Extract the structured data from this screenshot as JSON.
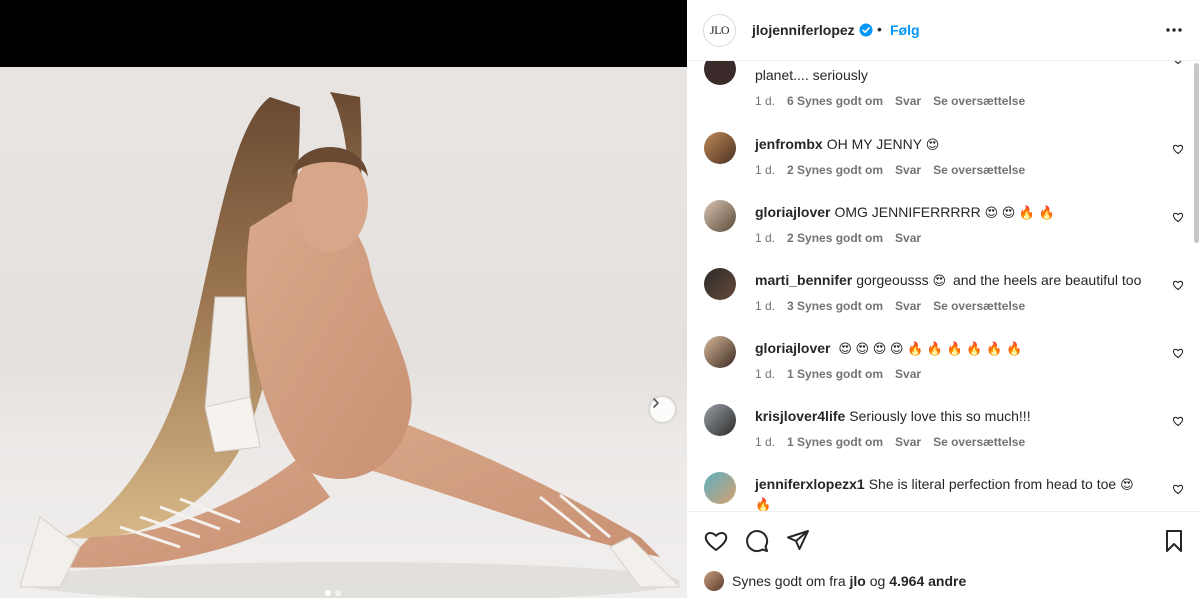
{
  "post": {
    "username": "jlojenniferlopez",
    "logo_text": "JLO",
    "separator": "•",
    "follow_label": "Følg"
  },
  "icons": {
    "verified": "verified-badge-icon",
    "more": "more-options-icon",
    "next": "chevron-right-icon",
    "heart": "heart-icon",
    "comment": "comment-icon",
    "share": "share-icon",
    "save": "bookmark-icon"
  },
  "colors": {
    "accent": "#0095f6",
    "text": "#262626",
    "muted": "#737373"
  },
  "comments": [
    {
      "user": "",
      "text": "planet.... seriously",
      "time": "1 d.",
      "likes": "6 Synes godt om",
      "reply": "Svar",
      "translate": "Se oversættelse"
    },
    {
      "user": "jenfrombx",
      "text": "OH MY JENNY",
      "emoji": "😍",
      "time": "1 d.",
      "likes": "2 Synes godt om",
      "reply": "Svar",
      "translate": "Se oversættelse"
    },
    {
      "user": "gloriajlover",
      "text": "OMG JENNIFERRRRR",
      "emoji": "😍 😍 🔥 🔥",
      "time": "1 d.",
      "likes": "2 Synes godt om",
      "reply": "Svar"
    },
    {
      "user": "marti_bennifer",
      "text": "gorgeousss",
      "emoji": "😍",
      "text2": "and the heels are beautiful too",
      "time": "1 d.",
      "likes": "3 Synes godt om",
      "reply": "Svar",
      "translate": "Se oversættelse"
    },
    {
      "user": "gloriajlover",
      "text": "",
      "emoji": "😍 😍 😍 😍 🔥 🔥 🔥 🔥 🔥 🔥",
      "time": "1 d.",
      "likes": "1 Synes godt om",
      "reply": "Svar"
    },
    {
      "user": "krisjlover4life",
      "text": "Seriously love this so much!!!",
      "time": "1 d.",
      "likes": "1 Synes godt om",
      "reply": "Svar",
      "translate": "Se oversættelse"
    },
    {
      "user": "jenniferxlopezx1",
      "text": "She is literal perfection from head to toe",
      "emoji": "😍",
      "emoji2": "🔥"
    }
  ],
  "likes": {
    "prefix": "Synes godt om fra",
    "first_user": "jlo",
    "conj": "og",
    "count": "4.964 andre"
  }
}
